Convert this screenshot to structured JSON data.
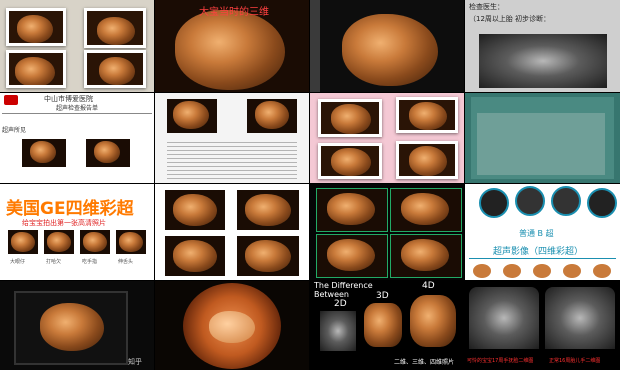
{
  "collage": {
    "c2_title": "大宝当时的三维",
    "c4_lines": [
      "检查医生：",
      "（12周以上胎  初步诊断："
    ],
    "c5_hospital": "中山市博爱医院",
    "c5_report": "超声检查报告单",
    "c5_section": "超声所见",
    "c9_banner": "美国GE四维彩超",
    "c9_subtitle": "给宝宝拍出第一张高清照片",
    "c9_caption": [
      "大眼仔",
      "打哈欠",
      "吃手指",
      "伸舌头"
    ],
    "c12_mid": "普通 B 超",
    "c12_main": "超声影像（四维彩超）",
    "c15_heading": "The Difference Between",
    "c15_labels": [
      "2D",
      "3D",
      "4D"
    ],
    "c15_caption": "二维、三维、四维照片",
    "c16_caption_left": "可怜的宝宝17周手抚脸二维图",
    "c16_caption_right": "正常16周胎儿手二维图",
    "c13_watermark": "知乎",
    "colors": {
      "banner_orange": "#ff7a00",
      "banner_red": "#e02020",
      "teal": "#1a8fb0",
      "red_caption": "#ff3030"
    }
  }
}
